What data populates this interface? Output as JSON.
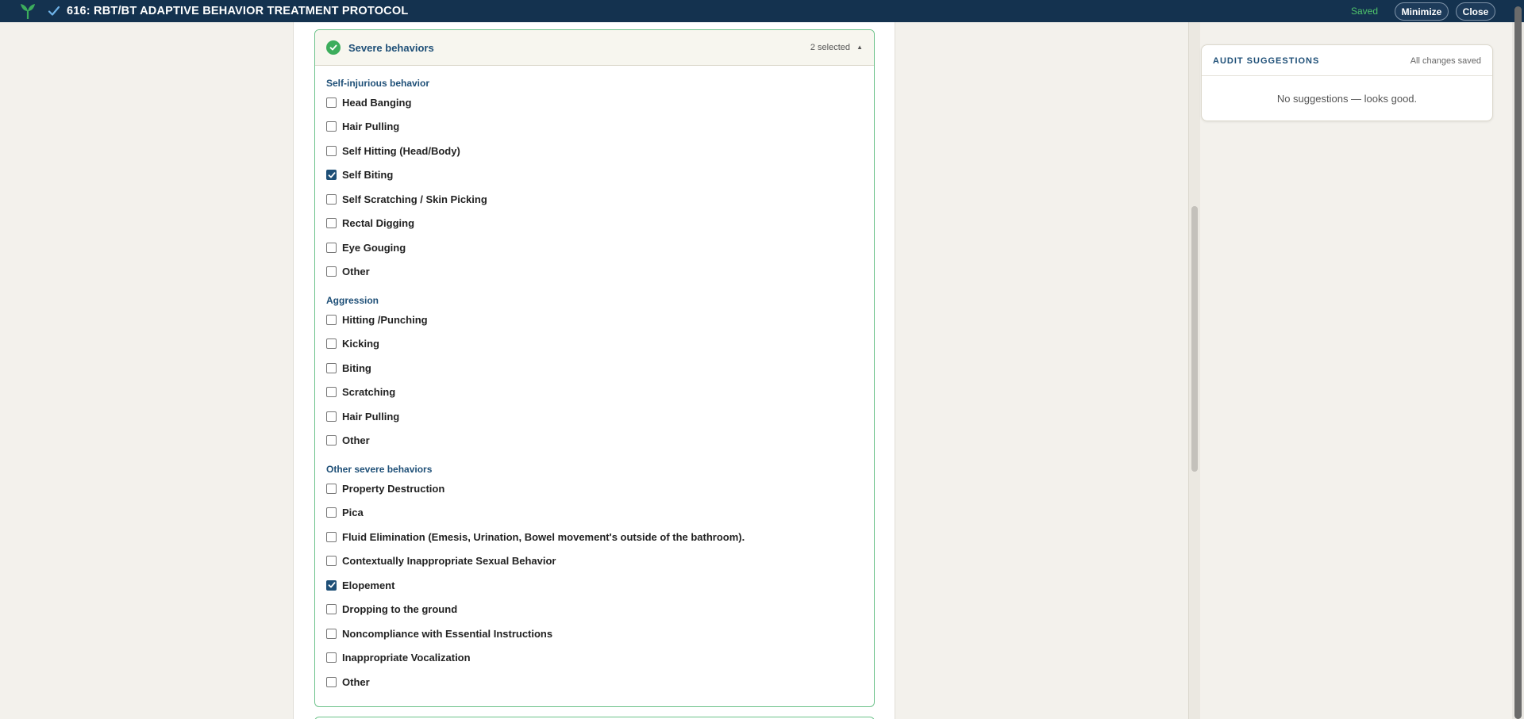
{
  "topbar": {
    "title": "616: RBT/BT ADAPTIVE BEHAVIOR TREATMENT PROTOCOL",
    "status": "Saved",
    "minimize_label": "Minimize",
    "close_label": "Close",
    "logo_icon": "sprout-icon",
    "check_icon": "checkmark-icon"
  },
  "section": {
    "title": "Severe behaviors",
    "count": "2 selected",
    "caret": "▲",
    "groups": [
      {
        "label": "Self-injurious behavior",
        "options": [
          {
            "label": "Head Banging",
            "checked": false
          },
          {
            "label": "Hair Pulling",
            "checked": false
          },
          {
            "label": "Self Hitting (Head/Body)",
            "checked": false
          },
          {
            "label": "Self Biting",
            "checked": true
          },
          {
            "label": "Self Scratching / Skin Picking",
            "checked": false
          },
          {
            "label": "Rectal Digging",
            "checked": false
          },
          {
            "label": "Eye Gouging",
            "checked": false
          },
          {
            "label": "Other",
            "checked": false
          }
        ]
      },
      {
        "label": "Aggression",
        "options": [
          {
            "label": "Hitting /Punching",
            "checked": false
          },
          {
            "label": "Kicking",
            "checked": false
          },
          {
            "label": "Biting",
            "checked": false
          },
          {
            "label": "Scratching",
            "checked": false
          },
          {
            "label": "Hair Pulling",
            "checked": false
          },
          {
            "label": "Other",
            "checked": false
          }
        ]
      },
      {
        "label": "Other severe behaviors",
        "options": [
          {
            "label": "Property Destruction",
            "checked": false
          },
          {
            "label": "Pica",
            "checked": false
          },
          {
            "label": "Fluid Elimination (Emesis, Urination, Bowel movement's outside of the bathroom).",
            "checked": false
          },
          {
            "label": "Contextually Inappropriate Sexual Behavior",
            "checked": false
          },
          {
            "label": "Elopement",
            "checked": true
          },
          {
            "label": "Dropping to the ground",
            "checked": false
          },
          {
            "label": "Noncompliance with Essential Instructions",
            "checked": false
          },
          {
            "label": "Inappropriate Vocalization",
            "checked": false
          },
          {
            "label": "Other",
            "checked": false
          }
        ]
      }
    ]
  },
  "audit": {
    "title": "AUDIT SUGGESTIONS",
    "status": "All changes saved",
    "message": "No suggestions — looks good."
  },
  "colors": {
    "topbar": "#14324f",
    "accent_green": "#3cad5c",
    "heading_blue": "#1e4f77",
    "saved_green": "#4fc36b"
  }
}
